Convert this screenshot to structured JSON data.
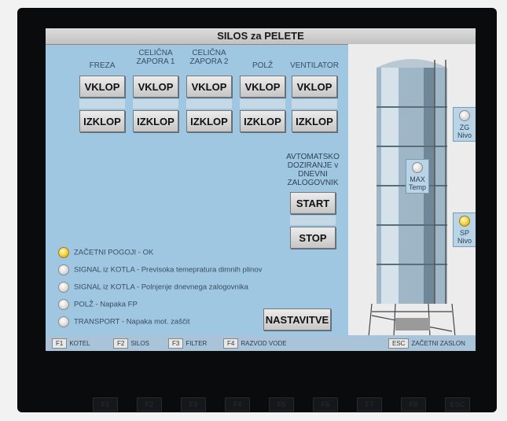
{
  "title": "SILOS za PELETE",
  "columns": [
    {
      "label": "FREZA",
      "on": "VKLOP",
      "off": "IZKLOP"
    },
    {
      "label": "CELIČNA ZAPORA 1",
      "on": "VKLOP",
      "off": "IZKLOP"
    },
    {
      "label": "CELIČNA ZAPORA 2",
      "on": "VKLOP",
      "off": "IZKLOP"
    },
    {
      "label": "POLŽ",
      "on": "VKLOP",
      "off": "IZKLOP"
    },
    {
      "label": "VENTILATOR",
      "on": "VKLOP",
      "off": "IZKLOP"
    }
  ],
  "auto": {
    "label": "AVTOMATSKO DOZIRANJE v DNEVNI ZALOGOVNIK",
    "start": "START",
    "stop": "STOP"
  },
  "signals": [
    {
      "text": "ZAČETNI POGOJI - OK",
      "active": true
    },
    {
      "text": "SIGNAL iz KOTLA - Previsoka temepratura dimnih plinov",
      "active": false
    },
    {
      "text": "SIGNAL iz KOTLA - Polnjenje dnevnega zalogovnika",
      "active": false
    },
    {
      "text": "POLŽ - Napaka FP",
      "active": false
    },
    {
      "text": "TRANSPORT - Napaka mot. zaščit",
      "active": false
    }
  ],
  "settings_button": "NASTAVITVE",
  "silo_indicators": [
    {
      "label": "ZG Nivo",
      "active": false
    },
    {
      "label": "MAX Temp",
      "active": false
    },
    {
      "label": "SP Nivo",
      "active": true
    }
  ],
  "function_keys": [
    {
      "key": "F1",
      "label": "KOTEL"
    },
    {
      "key": "F2",
      "label": "SILOS"
    },
    {
      "key": "F3",
      "label": "FILTER"
    },
    {
      "key": "F4",
      "label": "RAZVOD VODE"
    },
    {
      "key": "ESC",
      "label": "ZAČETNI ZASLON"
    }
  ],
  "hardware_keys": [
    "F1",
    "F2",
    "F3",
    "F4",
    "F5",
    "F6",
    "F7",
    "F8",
    "ESC"
  ]
}
